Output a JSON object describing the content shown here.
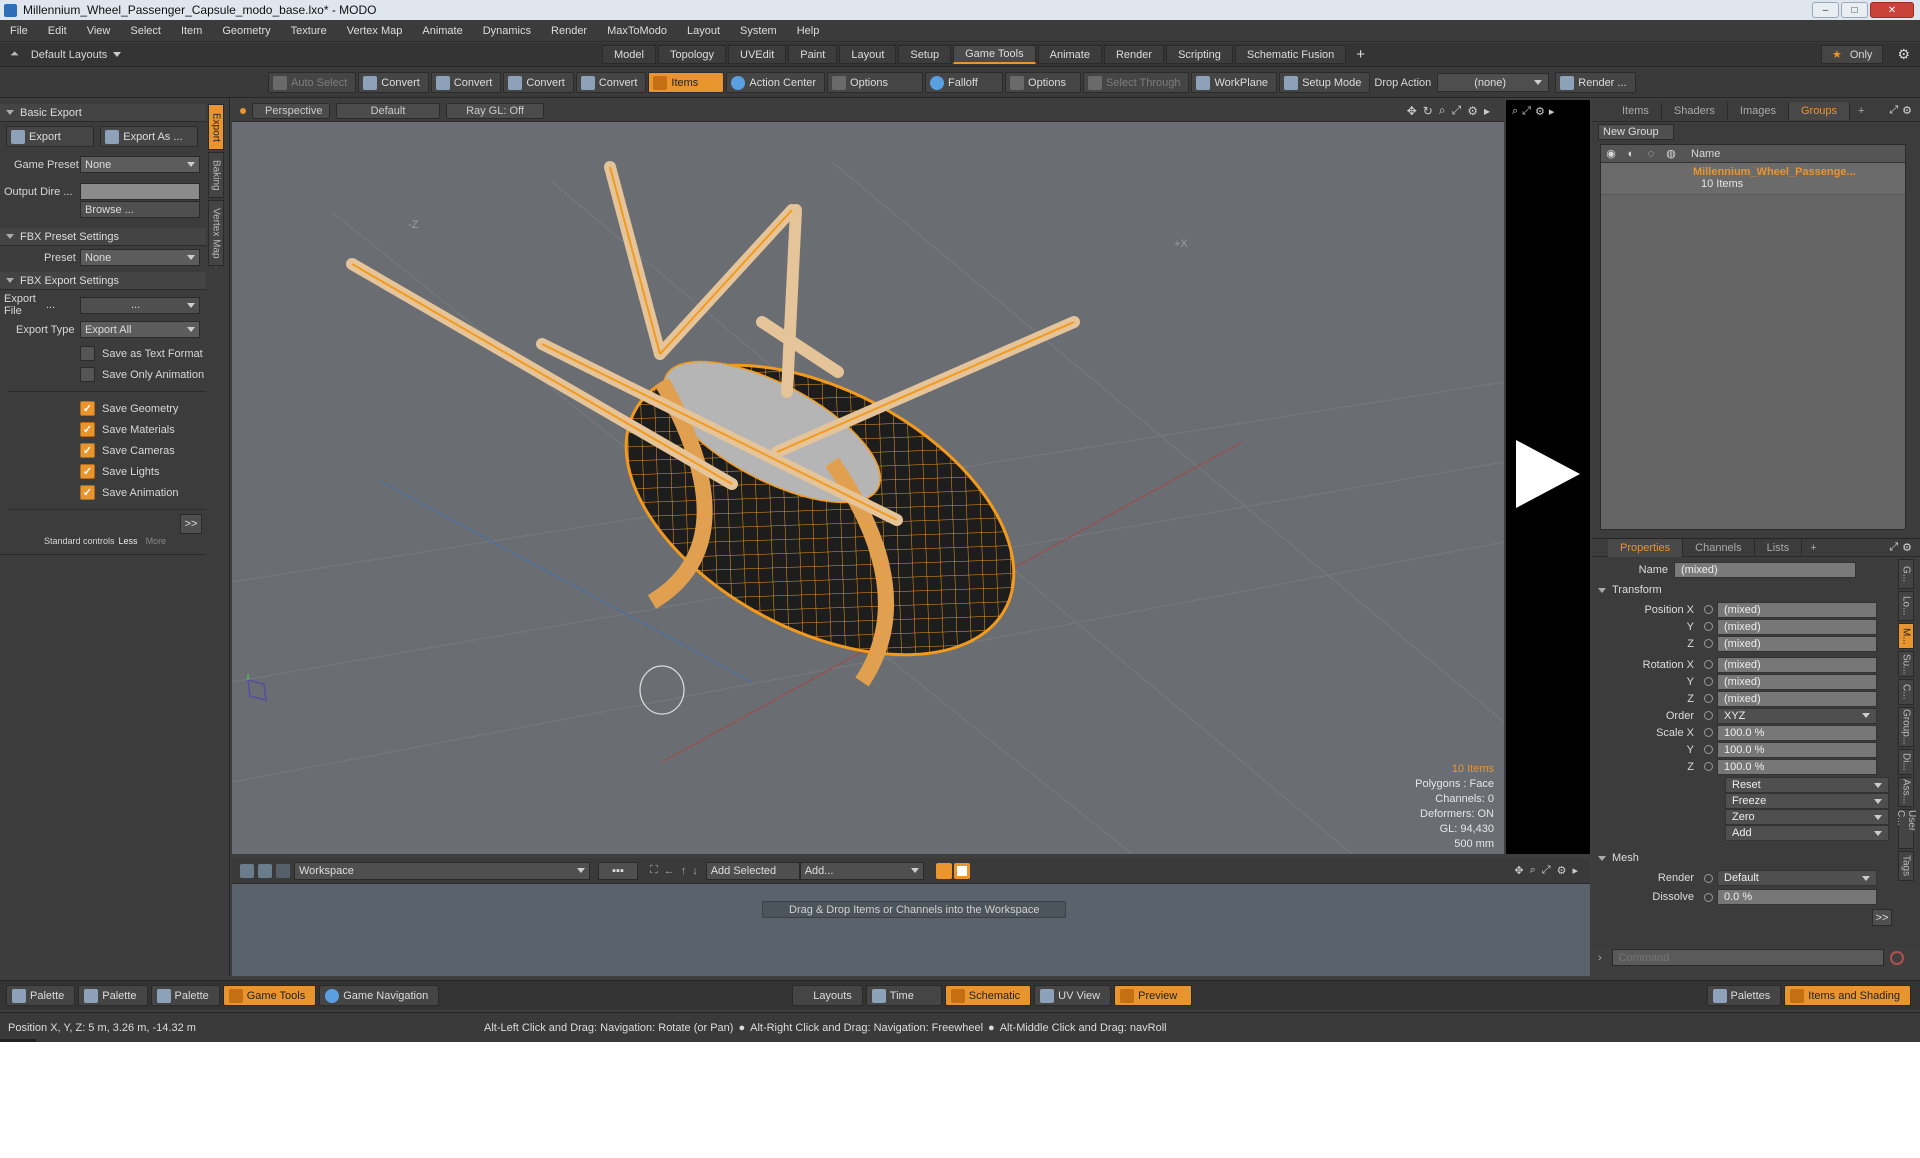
{
  "window": {
    "title": "Millennium_Wheel_Passenger_Capsule_modo_base.lxo* - MODO"
  },
  "menu": [
    "File",
    "Edit",
    "View",
    "Select",
    "Item",
    "Geometry",
    "Texture",
    "Vertex Map",
    "Animate",
    "Dynamics",
    "Render",
    "MaxToModo",
    "Layout",
    "System",
    "Help"
  ],
  "layouts": {
    "default_label": "Default Layouts",
    "tabs": [
      "Model",
      "Topology",
      "UVEdit",
      "Paint",
      "Layout",
      "Setup",
      "Game Tools",
      "Animate",
      "Render",
      "Scripting",
      "Schematic Fusion"
    ],
    "active": "Game Tools",
    "add": "+",
    "only_label": "Only",
    "star": "★",
    "gear": "⚙"
  },
  "toolbar": {
    "auto_select": "Auto Select",
    "convert": "Convert",
    "items": "Items",
    "action_center": "Action Center",
    "options": "Options",
    "falloff": "Falloff",
    "select_through": "Select Through",
    "workplane": "WorkPlane",
    "setup_mode": "Setup Mode",
    "drop_action": "Drop Action",
    "drop_value": "(none)",
    "render": "Render ..."
  },
  "left_panel": {
    "basic_export": "Basic Export",
    "export_btn": "Export",
    "export_as_btn": "Export As ...",
    "game_preset_label": "Game Preset",
    "game_preset_value": "None",
    "output_dir_label": "Output Dire ...",
    "browse": "Browse ...",
    "fbx_preset_settings": "FBX Preset Settings",
    "preset_label": "Preset",
    "preset_value": "None",
    "fbx_export_settings": "FBX Export Settings",
    "export_file_label": "Export File",
    "export_file_dots": "...",
    "export_file_value": "...",
    "export_type_label": "Export Type",
    "export_type_value": "Export All",
    "checkboxes": [
      {
        "label": "Save as Text Format",
        "checked": false
      },
      {
        "label": "Save Only Animation",
        "checked": false
      },
      {
        "label": "Save Geometry",
        "checked": true
      },
      {
        "label": "Save Materials",
        "checked": true
      },
      {
        "label": "Save Cameras",
        "checked": true
      },
      {
        "label": "Save Lights",
        "checked": true
      },
      {
        "label": "Save Animation",
        "checked": true
      }
    ],
    "expand": ">>",
    "standard_controls": "Standard controls",
    "less": "Less",
    "more": "More",
    "vtabs": [
      "Export",
      "Baking",
      "Vertex Map"
    ]
  },
  "viewport": {
    "view": "Perspective",
    "shading": "Default",
    "raygl": "Ray GL: Off",
    "axis_z": "-Z",
    "axis_x": "+X",
    "info": {
      "items": "10 Items",
      "polygons": "Polygons : Face",
      "channels": "Channels: 0",
      "deformers": "Deformers: ON",
      "gl": "GL: 94,430",
      "size": "500 mm"
    }
  },
  "workspace": {
    "name": "Workspace",
    "add_selected": "Add Selected",
    "add": "Add...",
    "hint": "Drag & Drop Items or Channels into the Workspace"
  },
  "groups_panel": {
    "tabs": [
      "Items",
      "Shaders",
      "Images",
      "Groups"
    ],
    "active": "Groups",
    "new_group": "New Group",
    "col_name": "Name",
    "group_name": "Millennium_Wheel_Passenge...",
    "group_count": "10 Items"
  },
  "props_panel": {
    "tabs": [
      "Properties",
      "Channels",
      "Lists"
    ],
    "active": "Properties",
    "name_label": "Name",
    "name_value": "(mixed)",
    "transform": "Transform",
    "rows": [
      {
        "label": "Position X",
        "value": "(mixed)"
      },
      {
        "label": "Y",
        "value": "(mixed)"
      },
      {
        "label": "Z",
        "value": "(mixed)"
      },
      {
        "label": "Rotation X",
        "value": "(mixed)"
      },
      {
        "label": "Y",
        "value": "(mixed)"
      },
      {
        "label": "Z",
        "value": "(mixed)"
      }
    ],
    "order_label": "Order",
    "order_value": "XYZ",
    "scale_rows": [
      {
        "label": "Scale X",
        "value": "100.0 %"
      },
      {
        "label": "Y",
        "value": "100.0 %"
      },
      {
        "label": "Z",
        "value": "100.0 %"
      }
    ],
    "actions": [
      "Reset",
      "Freeze",
      "Zero",
      "Add"
    ],
    "mesh": "Mesh",
    "render_label": "Render",
    "render_value": "Default",
    "dissolve_label": "Dissolve",
    "dissolve_value": "0.0 %",
    "expand": ">>",
    "side_tabs": [
      "G...",
      "Lo...",
      "M...",
      "Su...",
      "C...",
      "Group...",
      "Di...",
      "Ass...",
      "User C...",
      "Tags"
    ],
    "command_placeholder": "Command"
  },
  "bottom": {
    "left": [
      "Palette",
      "Palette",
      "Palette",
      "Game Tools",
      "Game Navigation"
    ],
    "center": [
      "Layouts",
      "Time",
      "Schematic",
      "UV View",
      "Preview"
    ],
    "right": [
      "Palettes",
      "Items and Shading"
    ]
  },
  "status": {
    "position": "Position X, Y, Z:  5 m, 3.26 m, -14.32 m",
    "hint1": "Alt-Left Click and Drag: Navigation: Rotate (or Pan)",
    "hint2": "Alt-Right Click and Drag: Navigation: Freewheel",
    "hint3": "Alt-Middle Click and Drag: navRoll"
  }
}
